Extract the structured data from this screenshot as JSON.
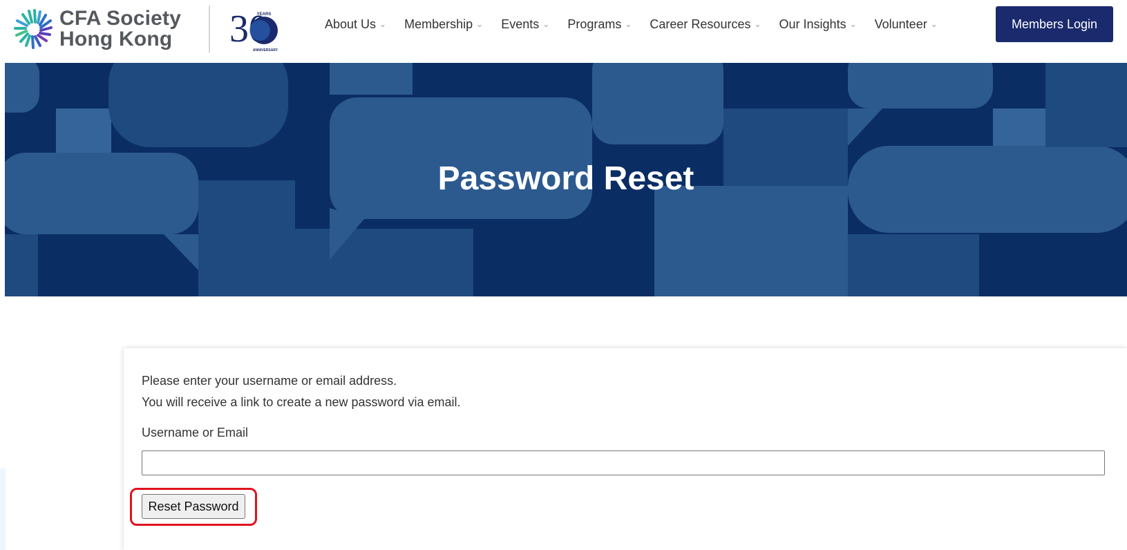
{
  "brand": {
    "name_line1": "CFA Society",
    "name_line2": "Hong Kong",
    "anniversary_number": "30",
    "anniversary_caption": "YEARS ANNIVERSARY"
  },
  "nav": {
    "items": [
      {
        "label": "About Us"
      },
      {
        "label": "Membership"
      },
      {
        "label": "Events"
      },
      {
        "label": "Programs"
      },
      {
        "label": "Career Resources"
      },
      {
        "label": "Our Insights"
      },
      {
        "label": "Volunteer"
      }
    ],
    "login_label": "Members Login"
  },
  "hero": {
    "title": "Password Reset"
  },
  "form": {
    "intro_line1": "Please enter your username or email address.",
    "intro_line2": "You will receive a link to create a new password via email.",
    "field_label": "Username or Email",
    "field_value": "",
    "submit_label": "Reset Password"
  },
  "colors": {
    "brand_navy": "#1a2a6c",
    "hero_dark": "#0a2d64",
    "hero_mid": "#1e4a80",
    "hero_light": "#2c5a8f",
    "logo_teal": "#2bb3a3",
    "logo_blue": "#2e6fc9",
    "highlight_red": "#e0121e"
  },
  "icons": {
    "nav_chevron": "chevron-down-icon",
    "logo": "cfa-starburst-logo",
    "anniversary": "30-years-anniversary-badge"
  }
}
